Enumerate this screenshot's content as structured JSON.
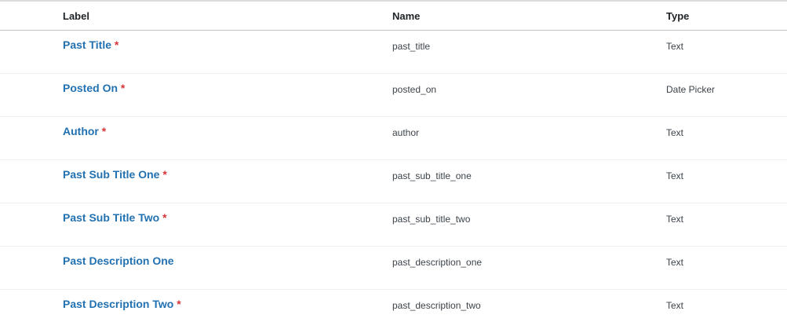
{
  "table": {
    "columns": {
      "label": "Label",
      "name": "Name",
      "type": "Type"
    },
    "rows": [
      {
        "label": "Past Title",
        "required": "*",
        "name": "past_title",
        "type": "Text"
      },
      {
        "label": "Posted On",
        "required": "*",
        "name": "posted_on",
        "type": "Date Picker"
      },
      {
        "label": "Author",
        "required": "*",
        "name": "author",
        "type": "Text"
      },
      {
        "label": "Past Sub Title One",
        "required": "*",
        "name": "past_sub_title_one",
        "type": "Text"
      },
      {
        "label": "Past Sub Title Two",
        "required": "*",
        "name": "past_sub_title_two",
        "type": "Text"
      },
      {
        "label": "Past Description One",
        "required": "",
        "name": "past_description_one",
        "type": "Text"
      },
      {
        "label": "Past Description Two",
        "required": "*",
        "name": "past_description_two",
        "type": "Text"
      }
    ]
  },
  "colors": {
    "link": "#2271b1",
    "required": "#d63638"
  }
}
